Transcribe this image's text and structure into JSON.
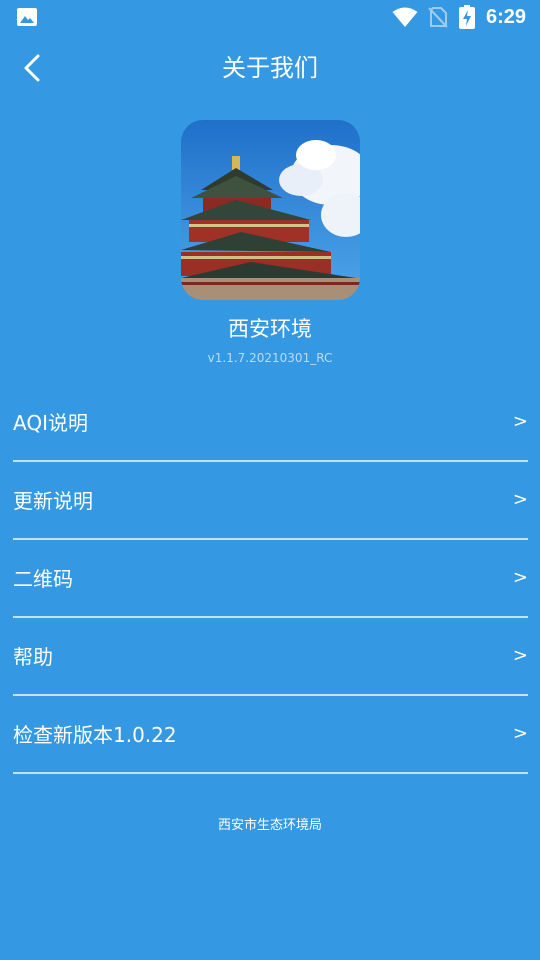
{
  "status_bar": {
    "time": "6:29",
    "icons": [
      "photo-icon",
      "wifi-icon",
      "no-sim-icon",
      "battery-charging-icon"
    ]
  },
  "header": {
    "title": "关于我们",
    "back_icon": "chevron-left-icon"
  },
  "app": {
    "name": "西安环境",
    "version": "v1.1.7.20210301_RC",
    "logo": "bell-tower-logo"
  },
  "menu": {
    "items": [
      {
        "label": "AQI说明",
        "arrow": ">"
      },
      {
        "label": "更新说明",
        "arrow": ">"
      },
      {
        "label": "二维码",
        "arrow": ">"
      },
      {
        "label": "帮助",
        "arrow": ">"
      },
      {
        "label": "检查新版本1.0.22",
        "arrow": ">"
      }
    ]
  },
  "footer": {
    "text": "西安市生态环境局"
  },
  "colors": {
    "background": "#3498e3",
    "divider": "#c6e2f7",
    "text": "#ffffff"
  }
}
